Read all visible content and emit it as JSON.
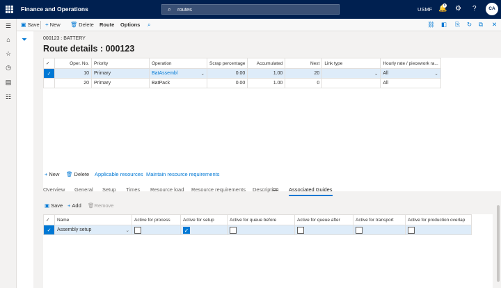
{
  "topbar": {
    "app_title": "Finance and Operations",
    "search_value": "routes",
    "company": "USMF",
    "avatar": "CA",
    "notification_count": "0"
  },
  "actionbar": {
    "save": "Save",
    "new": "New",
    "delete": "Delete",
    "route": "Route",
    "options": "Options"
  },
  "header": {
    "caption": "000123 : BATTERY",
    "title": "Route details : 000123"
  },
  "route_grid": {
    "columns": [
      "Oper. No.",
      "Priority",
      "Operation",
      "Scrap percentage",
      "Accumulated",
      "Next",
      "Link type",
      "Hourly rate / piecework ra..."
    ],
    "rows": [
      {
        "oper_no": "10",
        "priority": "Primary",
        "operation": "BatAssembl",
        "scrap": "0.00",
        "accumulated": "1.00",
        "next": "20",
        "link_type": "",
        "hourly_rate": "All"
      },
      {
        "oper_no": "20",
        "priority": "Primary",
        "operation": "BatPack",
        "scrap": "0.00",
        "accumulated": "1.00",
        "next": "0",
        "link_type": "",
        "hourly_rate": "All"
      }
    ]
  },
  "lower_toolbar": {
    "new": "New",
    "delete": "Delete",
    "applicable_resources": "Applicable resources",
    "maintain_requirements": "Maintain resource requirements"
  },
  "tabs": [
    "Overview",
    "General",
    "Setup",
    "Times",
    "Resource load",
    "Resource requirements",
    "Description",
    "Associated Guides"
  ],
  "sub_toolbar": {
    "save": "Save",
    "add": "Add",
    "remove": "Remove"
  },
  "guides_grid": {
    "columns": [
      "Name",
      "Active for process",
      "Active for setup",
      "Active for queue before",
      "Active for queue after",
      "Active for transport",
      "Active for production overlap"
    ],
    "rows": [
      {
        "name": "Assembly setup",
        "active_process": false,
        "active_setup": true,
        "active_queue_before": false,
        "active_queue_after": false,
        "active_transport": false,
        "active_overlap": false
      }
    ]
  },
  "colors": {
    "nav_bg": "#002050",
    "accent": "#0078d4",
    "selected_row": "#deecf9"
  }
}
